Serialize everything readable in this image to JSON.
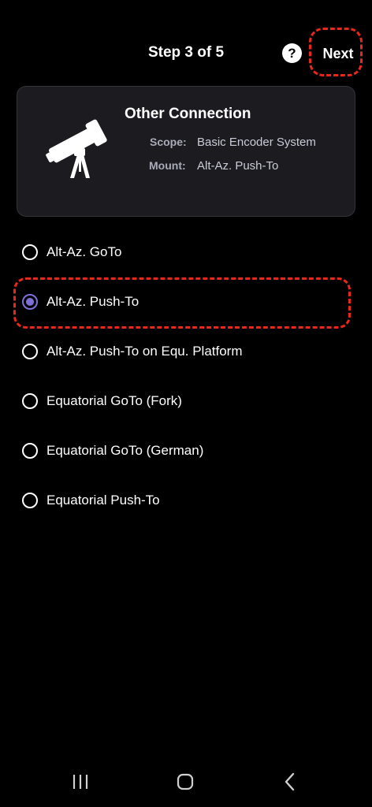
{
  "header": {
    "step": "Step 3 of 5",
    "help_icon": "?",
    "next_label": "Next"
  },
  "card": {
    "title": "Other Connection",
    "scope_label": "Scope:",
    "scope_value": "Basic Encoder System",
    "mount_label": "Mount:",
    "mount_value": "Alt-Az. Push-To",
    "icon": "telescope-icon"
  },
  "options": [
    {
      "label": "Alt-Az. GoTo",
      "selected": false
    },
    {
      "label": "Alt-Az. Push-To",
      "selected": true
    },
    {
      "label": "Alt-Az. Push-To on Equ. Platform",
      "selected": false
    },
    {
      "label": "Equatorial GoTo (Fork)",
      "selected": false
    },
    {
      "label": "Equatorial GoTo (German)",
      "selected": false
    },
    {
      "label": "Equatorial Push-To",
      "selected": false
    }
  ],
  "colors": {
    "accent": "#7f70d8",
    "highlight": "#e8271d",
    "card_bg": "#1c1c20"
  },
  "nav": {
    "recents_icon": "recents-icon",
    "home_icon": "home-icon",
    "back_icon": "back-icon"
  }
}
